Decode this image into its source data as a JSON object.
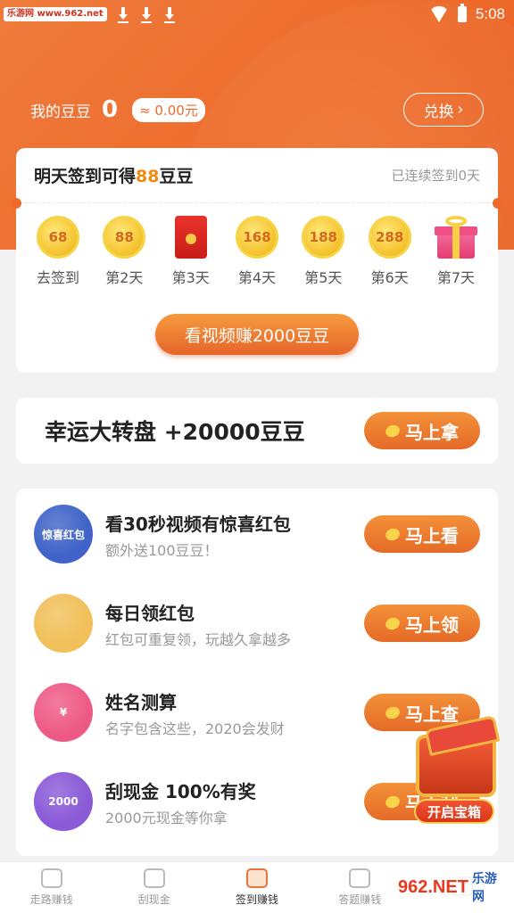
{
  "status": {
    "site_badge": "乐游网 www.962.net",
    "time": "5:08"
  },
  "header": {
    "balance_label": "我的豆豆",
    "balance_value": "0",
    "cash_value": "≈ 0.00元",
    "exchange_label": "兑换",
    "exchange_icon": "chevron-right-icon"
  },
  "signin": {
    "title_prefix": "明天签到可得",
    "title_amount": "88",
    "title_suffix": "豆豆",
    "streak": "已连续签到0天",
    "days": [
      {
        "type": "coin",
        "value": "68",
        "label": "去签到"
      },
      {
        "type": "coin",
        "value": "88",
        "label": "第2天"
      },
      {
        "type": "redpack",
        "value": "",
        "label": "第3天"
      },
      {
        "type": "coin",
        "value": "168",
        "label": "第4天"
      },
      {
        "type": "coin",
        "value": "188",
        "label": "第5天"
      },
      {
        "type": "coin",
        "value": "288",
        "label": "第6天"
      },
      {
        "type": "gift",
        "value": "",
        "label": "第7天"
      }
    ],
    "video_button": "看视频赚2000豆豆"
  },
  "wheel": {
    "title": "幸运大转盘 +20000豆豆",
    "button": "马上拿"
  },
  "tasks": [
    {
      "title": "看30秒视频有惊喜红包",
      "subtitle": "额外送100豆豆！",
      "button": "马上看",
      "icon_text": "惊喜红包",
      "icon": "surprise-redpack-icon",
      "color": "#3f63c8"
    },
    {
      "title": "每日领红包",
      "subtitle": "红包可重复领，玩越久拿越多",
      "button": "马上领",
      "icon_text": "",
      "icon": "redpack-bundle-icon",
      "color": "#f1c05a"
    },
    {
      "title": "姓名测算",
      "subtitle": "名字包含这些，2020会发财",
      "button": "马上查",
      "icon_text": "¥",
      "icon": "name-fortune-icon",
      "color": "#ee5a86"
    },
    {
      "title": "刮现金 100%有奖",
      "subtitle": "2000元现金等你拿",
      "button": "马上刮",
      "icon_text": "2000",
      "icon": "scratch-card-icon",
      "color": "#8a5ad8"
    }
  ],
  "treasure": {
    "label": "开启宝箱"
  },
  "bottom_nav": [
    {
      "label": "走路赚钱",
      "icon": "shoe-icon",
      "active": false
    },
    {
      "label": "刮现金",
      "icon": "bean-icon",
      "active": false
    },
    {
      "label": "签到赚钱",
      "icon": "gift-icon",
      "active": true
    },
    {
      "label": "答题赚钱",
      "icon": "book-icon",
      "active": false
    },
    {
      "label": "",
      "icon": "profile-icon",
      "active": false
    }
  ],
  "watermark": {
    "logo": "962.NET",
    "text": "乐游网"
  },
  "colors": {
    "primary": "#ef6a2b",
    "accent_text": "#f28a10",
    "button_gradient_top": "#f3913a",
    "button_gradient_bottom": "#e56a27"
  }
}
